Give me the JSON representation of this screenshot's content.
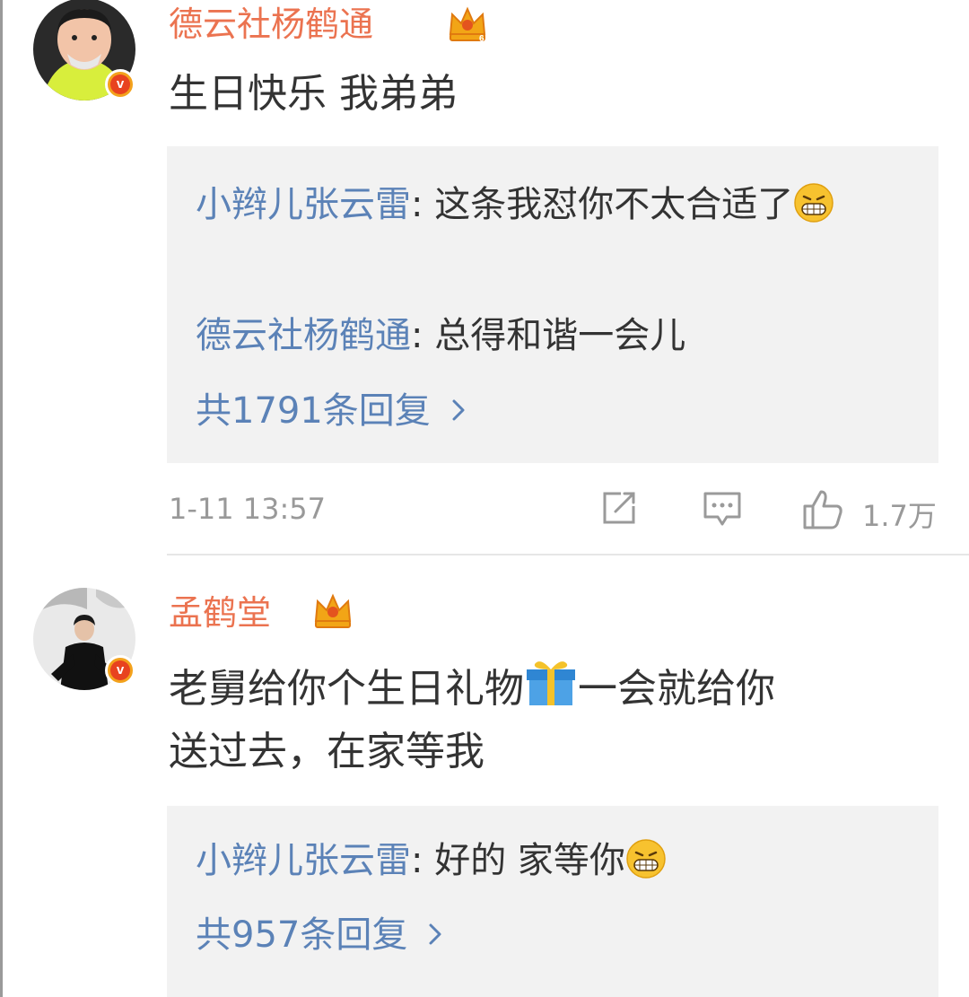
{
  "comments": [
    {
      "username": "德云社杨鹤通",
      "text": "生日快乐 我弟弟",
      "replies": [
        {
          "name": "小辫儿张云雷",
          "text": ": 这条我怼你不太合适了"
        },
        {
          "name": "德云社杨鹤通",
          "text": ": 总得和谐一会儿"
        }
      ],
      "more_replies": "共1791条回复",
      "time": "1-11 13:57",
      "likes": "1.7万"
    },
    {
      "username": "孟鹤堂",
      "text_line1": "老舅给你个生日礼物",
      "text_line1b": "一会就给你",
      "text_line2": "送过去，在家等我",
      "replies": [
        {
          "name": "小辫儿张云雷",
          "text": ": 好的 家等你"
        }
      ],
      "more_replies": "共957条回复"
    }
  ],
  "icons": {
    "crown": "crown-icon",
    "verified": "verified-badge-icon",
    "grin": "grin-emoji-icon",
    "gift": "gift-emoji-icon",
    "share": "share-icon",
    "comment": "comment-icon",
    "like": "thumbs-up-icon",
    "chevron": "chevron-right-icon"
  },
  "colors": {
    "username": "#eb7350",
    "reply_name": "#5b82b7",
    "reply_bg": "#f2f2f2",
    "meta": "#999999"
  }
}
